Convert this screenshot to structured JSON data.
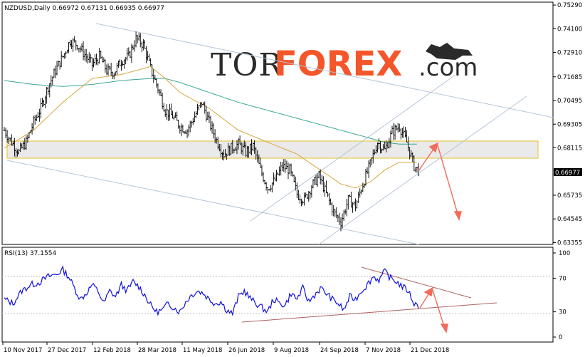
{
  "chart_data": {
    "type": "candlestick",
    "symbol_line": "NZDUSD,Daily  0.66972 0.67131 0.66935 0.66977",
    "current_price_label": "0.66977",
    "price_ylim": [
      0.633,
      0.754
    ],
    "price_ticks": [
      "0.75290",
      "0.74100",
      "0.72910",
      "0.71685",
      "0.70495",
      "0.69305",
      "0.68115",
      "0.66977",
      "0.65735",
      "0.64545",
      "0.63355"
    ],
    "date_ticks": [
      "10 Nov 2017",
      "27 Dec 2017",
      "12 Feb 2018",
      "28 Mar 2018",
      "11 May 2018",
      "26 Jun 2018",
      "9 Aug 2018",
      "24 Sep 2018",
      "7 Nov 2018",
      "21 Dec 2018"
    ],
    "price_path": [
      [
        0,
        0.69
      ],
      [
        5,
        0.684
      ],
      [
        10,
        0.679
      ],
      [
        15,
        0.684
      ],
      [
        20,
        0.694
      ],
      [
        25,
        0.701
      ],
      [
        30,
        0.712
      ],
      [
        35,
        0.72
      ],
      [
        40,
        0.727
      ],
      [
        45,
        0.735
      ],
      [
        50,
        0.733
      ],
      [
        55,
        0.728
      ],
      [
        60,
        0.723
      ],
      [
        65,
        0.727
      ],
      [
        70,
        0.72
      ],
      [
        75,
        0.719
      ],
      [
        80,
        0.725
      ],
      [
        85,
        0.727
      ],
      [
        90,
        0.736
      ],
      [
        95,
        0.733
      ],
      [
        100,
        0.721
      ],
      [
        105,
        0.711
      ],
      [
        110,
        0.7
      ],
      [
        115,
        0.697
      ],
      [
        120,
        0.692
      ],
      [
        125,
        0.69
      ],
      [
        130,
        0.697
      ],
      [
        135,
        0.704
      ],
      [
        140,
        0.694
      ],
      [
        145,
        0.685
      ],
      [
        150,
        0.678
      ],
      [
        155,
        0.681
      ],
      [
        160,
        0.683
      ],
      [
        165,
        0.679
      ],
      [
        170,
        0.682
      ],
      [
        175,
        0.67
      ],
      [
        180,
        0.661
      ],
      [
        185,
        0.665
      ],
      [
        190,
        0.672
      ],
      [
        195,
        0.67
      ],
      [
        200,
        0.658
      ],
      [
        205,
        0.655
      ],
      [
        210,
        0.662
      ],
      [
        215,
        0.667
      ],
      [
        220,
        0.658
      ],
      [
        225,
        0.649
      ],
      [
        230,
        0.644
      ],
      [
        235,
        0.655
      ],
      [
        240,
        0.652
      ],
      [
        245,
        0.663
      ],
      [
        250,
        0.673
      ],
      [
        255,
        0.684
      ],
      [
        260,
        0.68
      ],
      [
        265,
        0.689
      ],
      [
        270,
        0.692
      ],
      [
        275,
        0.684
      ],
      [
        280,
        0.672
      ],
      [
        283,
        0.6698
      ]
    ],
    "ma_fast_path": [
      [
        0,
        0.681
      ],
      [
        20,
        0.69
      ],
      [
        40,
        0.704
      ],
      [
        60,
        0.716
      ],
      [
        80,
        0.718
      ],
      [
        100,
        0.722
      ],
      [
        110,
        0.716
      ],
      [
        120,
        0.709
      ],
      [
        140,
        0.701
      ],
      [
        160,
        0.69
      ],
      [
        180,
        0.684
      ],
      [
        200,
        0.678
      ],
      [
        220,
        0.668
      ],
      [
        230,
        0.663
      ],
      [
        240,
        0.661
      ],
      [
        250,
        0.664
      ],
      [
        260,
        0.67
      ],
      [
        270,
        0.674
      ],
      [
        280,
        0.674
      ]
    ],
    "ma_slow_path": [
      [
        0,
        0.715
      ],
      [
        20,
        0.713
      ],
      [
        40,
        0.712
      ],
      [
        60,
        0.713
      ],
      [
        80,
        0.715
      ],
      [
        100,
        0.716
      ],
      [
        110,
        0.716
      ],
      [
        120,
        0.714
      ],
      [
        140,
        0.709
      ],
      [
        160,
        0.704
      ],
      [
        180,
        0.7
      ],
      [
        200,
        0.696
      ],
      [
        220,
        0.692
      ],
      [
        240,
        0.688
      ],
      [
        250,
        0.686
      ],
      [
        260,
        0.684
      ],
      [
        270,
        0.683
      ],
      [
        280,
        0.683
      ]
    ],
    "rsi": {
      "label": "RSI(13) 37.1554",
      "ylim": [
        0,
        100
      ],
      "ticks": [
        "100",
        "70",
        "30",
        "0"
      ],
      "path": [
        [
          0,
          45
        ],
        [
          6,
          40
        ],
        [
          12,
          55
        ],
        [
          18,
          62
        ],
        [
          24,
          65
        ],
        [
          30,
          72
        ],
        [
          36,
          75
        ],
        [
          40,
          80
        ],
        [
          44,
          72
        ],
        [
          48,
          58
        ],
        [
          52,
          45
        ],
        [
          56,
          52
        ],
        [
          60,
          62
        ],
        [
          64,
          55
        ],
        [
          68,
          40
        ],
        [
          72,
          55
        ],
        [
          76,
          48
        ],
        [
          80,
          62
        ],
        [
          84,
          55
        ],
        [
          88,
          66
        ],
        [
          92,
          60
        ],
        [
          96,
          50
        ],
        [
          100,
          38
        ],
        [
          104,
          30
        ],
        [
          108,
          32
        ],
        [
          112,
          40
        ],
        [
          116,
          35
        ],
        [
          120,
          30
        ],
        [
          124,
          42
        ],
        [
          128,
          50
        ],
        [
          132,
          55
        ],
        [
          136,
          52
        ],
        [
          140,
          45
        ],
        [
          144,
          40
        ],
        [
          148,
          42
        ],
        [
          152,
          32
        ],
        [
          156,
          28
        ],
        [
          160,
          48
        ],
        [
          164,
          55
        ],
        [
          168,
          46
        ],
        [
          172,
          40
        ],
        [
          176,
          35
        ],
        [
          180,
          30
        ],
        [
          184,
          45
        ],
        [
          188,
          40
        ],
        [
          192,
          38
        ],
        [
          196,
          52
        ],
        [
          200,
          45
        ],
        [
          204,
          58
        ],
        [
          208,
          42
        ],
        [
          212,
          50
        ],
        [
          216,
          58
        ],
        [
          220,
          52
        ],
        [
          224,
          45
        ],
        [
          228,
          40
        ],
        [
          232,
          32
        ],
        [
          236,
          48
        ],
        [
          240,
          45
        ],
        [
          244,
          55
        ],
        [
          248,
          62
        ],
        [
          252,
          72
        ],
        [
          256,
          68
        ],
        [
          260,
          78
        ],
        [
          264,
          70
        ],
        [
          268,
          66
        ],
        [
          272,
          60
        ],
        [
          276,
          55
        ],
        [
          280,
          40
        ],
        [
          283,
          37
        ]
      ]
    }
  }
}
